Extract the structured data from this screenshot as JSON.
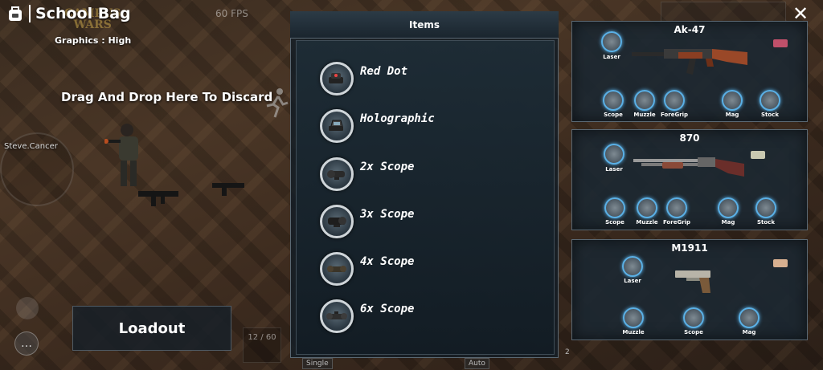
{
  "header": {
    "title": "School Bag",
    "graphics": "Graphics : High",
    "logo_line1": "CAMPUS",
    "logo_line2": "WARS",
    "fps": "60 FPS"
  },
  "discard_text": "Drag And Drop Here To Discard",
  "player_name": "Steve.Cancer",
  "loadout_label": "Loadout",
  "ammo_counter": "12 / 60",
  "items_panel": {
    "title": "Items",
    "items": [
      {
        "label": "Red Dot",
        "icon": "red-dot-sight-icon"
      },
      {
        "label": "Holographic",
        "icon": "holographic-sight-icon"
      },
      {
        "label": "2x Scope",
        "icon": "2x-scope-icon"
      },
      {
        "label": "3x Scope",
        "icon": "3x-scope-icon"
      },
      {
        "label": "4x Scope",
        "icon": "4x-scope-icon"
      },
      {
        "label": "6x Scope",
        "icon": "6x-scope-icon"
      }
    ],
    "bottom_tabs": [
      "Single",
      "Auto"
    ],
    "bottom_num": "2"
  },
  "weapons": [
    {
      "name": "Ak-47",
      "slots": {
        "laser": "Laser",
        "scope": "Scope",
        "muzzle": "Muzzle",
        "foregrip": "ForeGrip",
        "mag": "Mag",
        "stock": "Stock"
      },
      "ammo_color": "#c0506a"
    },
    {
      "name": "870",
      "slots": {
        "laser": "Laser",
        "scope": "Scope",
        "muzzle": "Muzzle",
        "foregrip": "ForeGrip",
        "mag": "Mag",
        "stock": "Stock"
      },
      "ammo_color": "#c8c8b0"
    },
    {
      "name": "M1911",
      "slots": {
        "laser": "Laser",
        "muzzle": "Muzzle",
        "scope": "Scope",
        "mag": "Mag"
      },
      "ammo_color": "#d8b090"
    }
  ],
  "colors": {
    "slot_ring": "#5ab0e6",
    "panel_bg": "#1c2832",
    "panel_border": "#5a6873"
  }
}
